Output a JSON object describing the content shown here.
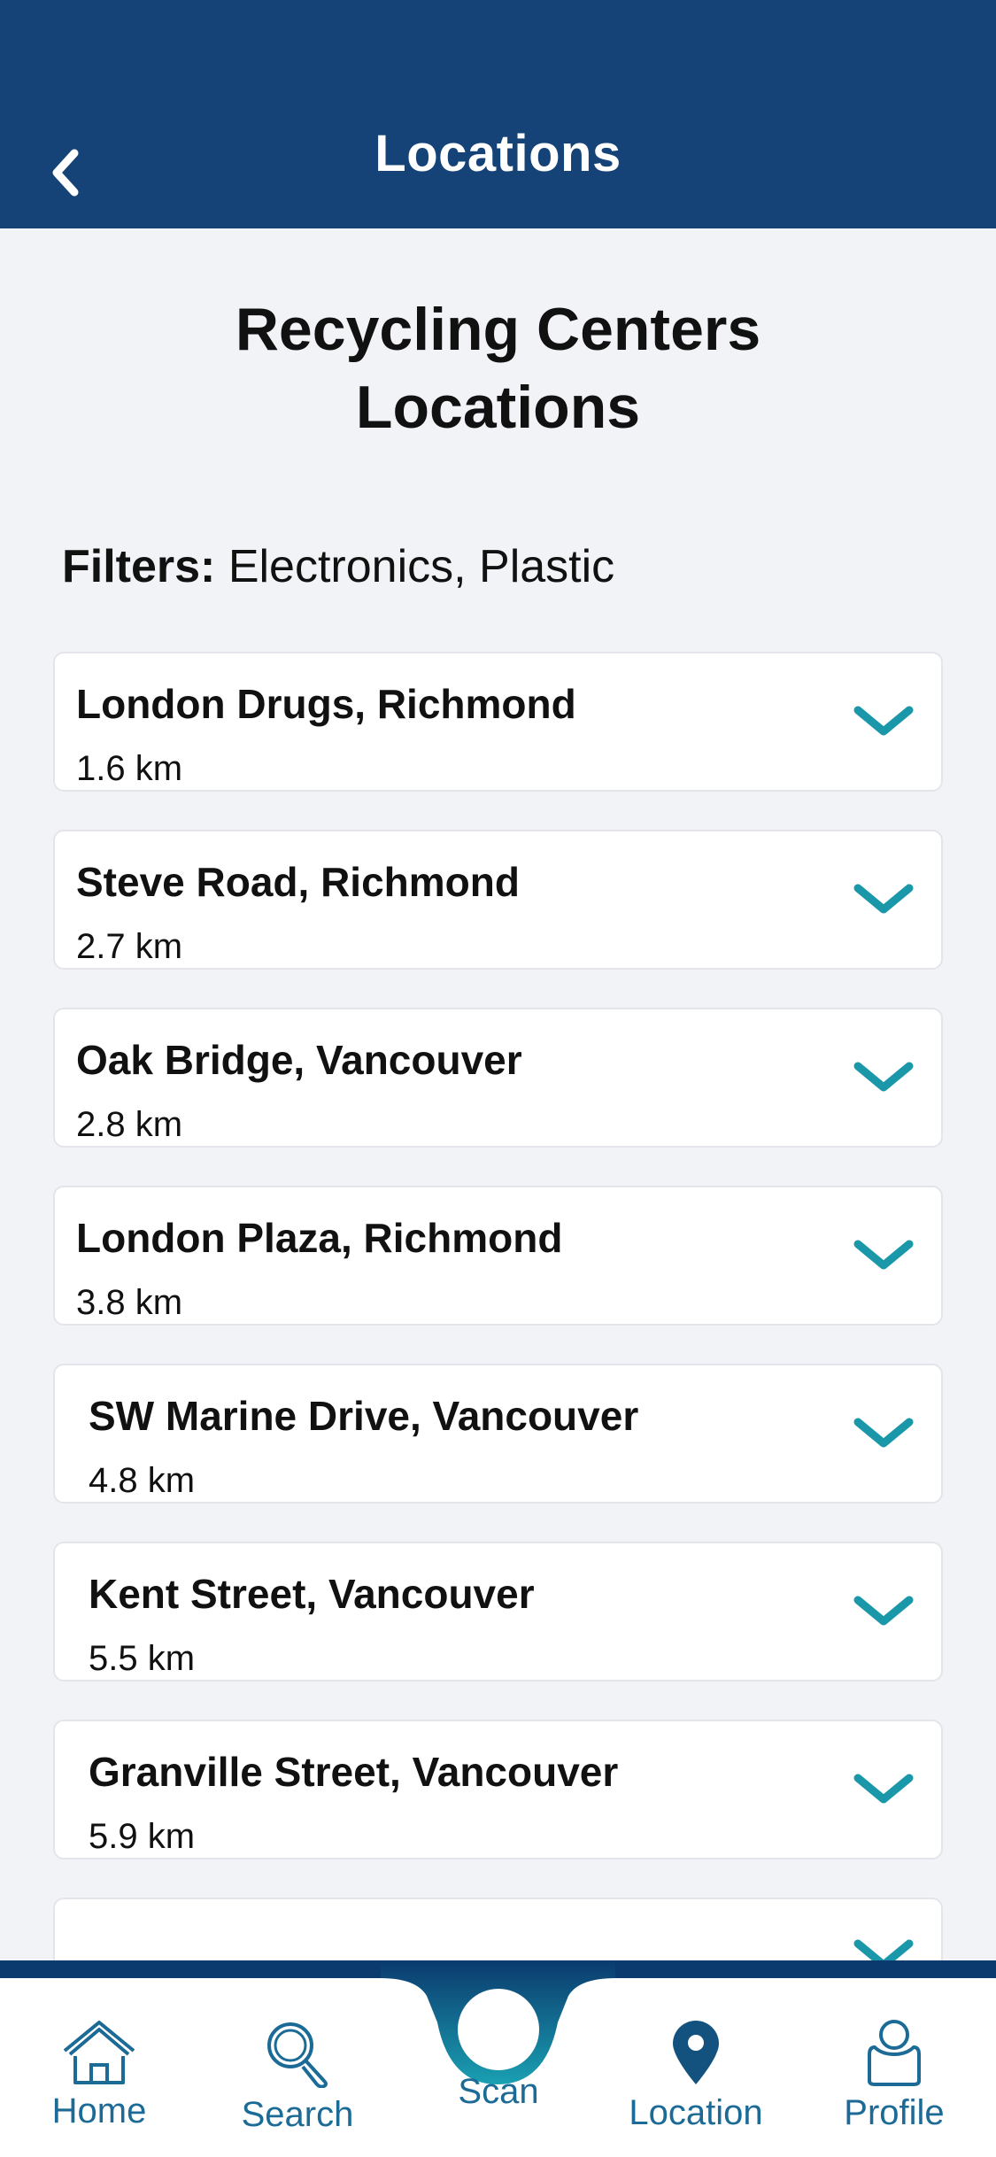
{
  "header": {
    "title": "Locations",
    "back_icon": "chevron-left-icon"
  },
  "page": {
    "title_line1": "Recycling Centers",
    "title_line2": "Locations",
    "filters_label": "Filters:",
    "filters_value": " Electronics, Plastic"
  },
  "locations": [
    {
      "name": "London Drugs, Richmond",
      "distance": "1.6 km"
    },
    {
      "name": "Steve Road, Richmond",
      "distance": "2.7 km"
    },
    {
      "name": "Oak Bridge, Vancouver",
      "distance": "2.8 km"
    },
    {
      "name": "London Plaza, Richmond",
      "distance": "3.8 km"
    },
    {
      "name": "SW Marine Drive, Vancouver",
      "distance": "4.8 km"
    },
    {
      "name": "Kent Street, Vancouver",
      "distance": "5.5 km"
    },
    {
      "name": "Granville Street, Vancouver",
      "distance": "5.9 km"
    }
  ],
  "tabs": {
    "home": "Home",
    "search": "Search",
    "scan": "Scan",
    "location": "Location",
    "profile": "Profile"
  },
  "colors": {
    "header_bg": "#164377",
    "accent_teal": "#1a97a8",
    "tab_text": "#1c6a96",
    "page_bg": "#f1f3f7"
  }
}
